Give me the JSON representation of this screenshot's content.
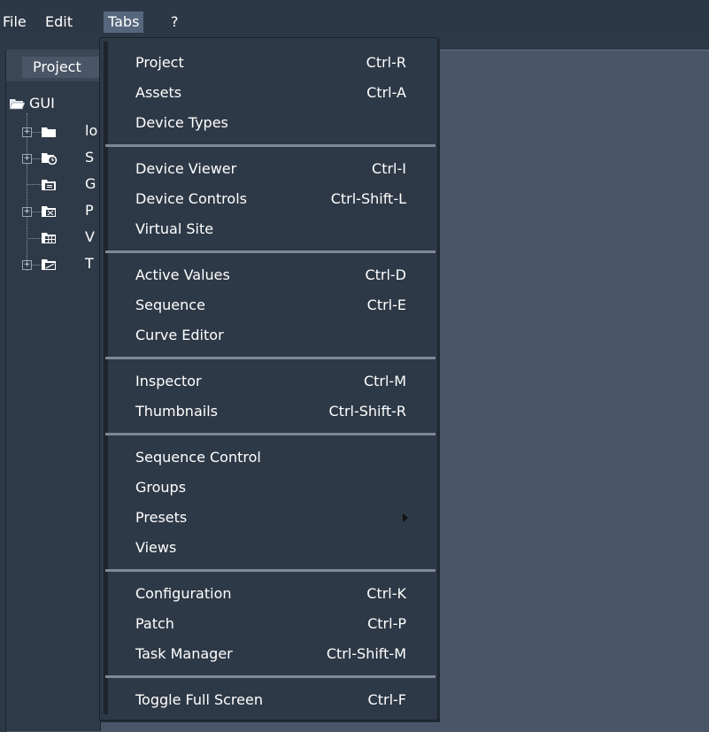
{
  "menubar": {
    "items": [
      {
        "label": "File"
      },
      {
        "label": "Edit"
      },
      {
        "label": "Tabs"
      },
      {
        "label": "?"
      }
    ]
  },
  "panel": {
    "tab_label": "Project",
    "tree_root": "GUI",
    "tree_items": [
      "lo",
      "S",
      "G",
      "P",
      "V",
      "T"
    ]
  },
  "tabs_menu": {
    "items": [
      {
        "label": "Project",
        "shortcut": "Ctrl-R"
      },
      {
        "label": "Assets",
        "shortcut": "Ctrl-A"
      },
      {
        "label": "Device Types",
        "shortcut": ""
      },
      {
        "label": "Device Viewer",
        "shortcut": "Ctrl-I"
      },
      {
        "label": "Device Controls",
        "shortcut": "Ctrl-Shift-L"
      },
      {
        "label": "Virtual Site",
        "shortcut": ""
      },
      {
        "label": "Active Values",
        "shortcut": "Ctrl-D"
      },
      {
        "label": "Sequence",
        "shortcut": "Ctrl-E"
      },
      {
        "label": "Curve Editor",
        "shortcut": ""
      },
      {
        "label": "Inspector",
        "shortcut": "Ctrl-M"
      },
      {
        "label": "Thumbnails",
        "shortcut": "Ctrl-Shift-R"
      },
      {
        "label": "Sequence Control",
        "shortcut": ""
      },
      {
        "label": "Groups",
        "shortcut": ""
      },
      {
        "label": "Presets",
        "shortcut": ""
      },
      {
        "label": "Views",
        "shortcut": ""
      },
      {
        "label": "Configuration",
        "shortcut": "Ctrl-K"
      },
      {
        "label": "Patch",
        "shortcut": "Ctrl-P"
      },
      {
        "label": "Task Manager",
        "shortcut": "Ctrl-Shift-M"
      },
      {
        "label": "Toggle Full Screen",
        "shortcut": "Ctrl-F"
      }
    ]
  },
  "colors": {
    "menubar_bg": "#2d3846",
    "menu_bg": "#2e3947",
    "workspace_bg": "#4a5668",
    "active_menu_bg": "#56667c",
    "separator": "#7e8896"
  }
}
